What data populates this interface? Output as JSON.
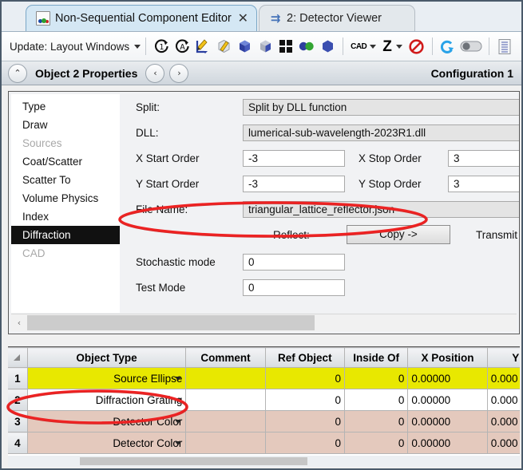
{
  "window": {
    "tabs": [
      {
        "label": "Non-Sequential Component Editor",
        "icon": "document-icon",
        "close": "✕",
        "active": true
      },
      {
        "label": "2: Detector Viewer",
        "icon": "arrow-bar-icon",
        "active": false
      }
    ]
  },
  "toolbar": {
    "update_label": "Update: Layout Windows",
    "icons": [
      "update-1-icon",
      "update-all-icon",
      "edit-draw-icon",
      "solid-pencil-icon",
      "cube-icon",
      "shaded-cube-icon",
      "grid-4-icon",
      "two-circles-icon",
      "hexagon-icon"
    ],
    "cad_label": "CAD",
    "z_label": "Z",
    "right_icons": [
      "no-entry-icon",
      "refresh-arrow-icon",
      "toggle-switch-icon",
      "list-report-icon"
    ]
  },
  "properties_header": {
    "collapse_icon": "⌃",
    "title": "Object  2 Properties",
    "prev_icon": "‹",
    "next_icon": "›",
    "config_label": "Configuration 1"
  },
  "sidebar": {
    "items": [
      {
        "label": "Type",
        "state": "normal"
      },
      {
        "label": "Draw",
        "state": "normal"
      },
      {
        "label": "Sources",
        "state": "disabled"
      },
      {
        "label": "Coat/Scatter",
        "state": "normal"
      },
      {
        "label": "Scatter To",
        "state": "normal"
      },
      {
        "label": "Volume Physics",
        "state": "normal"
      },
      {
        "label": "Index",
        "state": "normal"
      },
      {
        "label": "Diffraction",
        "state": "selected"
      },
      {
        "label": "CAD",
        "state": "disabled"
      }
    ],
    "scroll_left_icon": "‹"
  },
  "fields": {
    "split_label": "Split:",
    "split_value": "Split by DLL function",
    "dll_label": "DLL:",
    "dll_value": "lumerical-sub-wavelength-2023R1.dll",
    "x_start_label": "X Start Order",
    "x_start_value": "-3",
    "x_stop_label": "X Stop Order",
    "x_stop_value": "3",
    "y_start_label": "Y Start Order",
    "y_start_value": "-3",
    "y_stop_label": "Y Stop Order",
    "y_stop_value": "3",
    "file_name_label": "File Name:",
    "file_name_value": "triangular_lattice_reflector.json",
    "reflect_label": "Reflect:",
    "copy_button_label": "Copy ->",
    "transmit_label": "Transmit",
    "stochastic_label": "Stochastic mode",
    "stochastic_value": "0",
    "test_mode_label": "Test Mode",
    "test_mode_value": "0"
  },
  "table": {
    "columns": [
      "Object Type",
      "Comment",
      "Ref Object",
      "Inside Of",
      "X Position",
      "Y Pos"
    ],
    "rows": [
      {
        "num": "1",
        "object_type": "Source Ellipse",
        "comment": "",
        "ref_object": "0",
        "inside_of": "0",
        "x_position": "0.00000",
        "y_position": "0.000",
        "style": "r-yellow"
      },
      {
        "num": "2",
        "object_type": "Diffraction Grating",
        "comment": "",
        "ref_object": "0",
        "inside_of": "0",
        "x_position": "0.00000",
        "y_position": "0.000",
        "style": "r-white"
      },
      {
        "num": "3",
        "object_type": "Detector Color",
        "comment": "",
        "ref_object": "0",
        "inside_of": "0",
        "x_position": "0.00000",
        "y_position": "0.000",
        "style": "r-pink"
      },
      {
        "num": "4",
        "object_type": "Detector Color",
        "comment": "",
        "ref_object": "0",
        "inside_of": "0",
        "x_position": "0.00000",
        "y_position": "0.000",
        "style": "r-pink"
      }
    ]
  },
  "annotations": {
    "highlight_color": "#ee2222",
    "ellipse_file_name": "file-name-row-highlight",
    "ellipse_diffraction_grating": "diffraction-grating-row-highlight"
  }
}
